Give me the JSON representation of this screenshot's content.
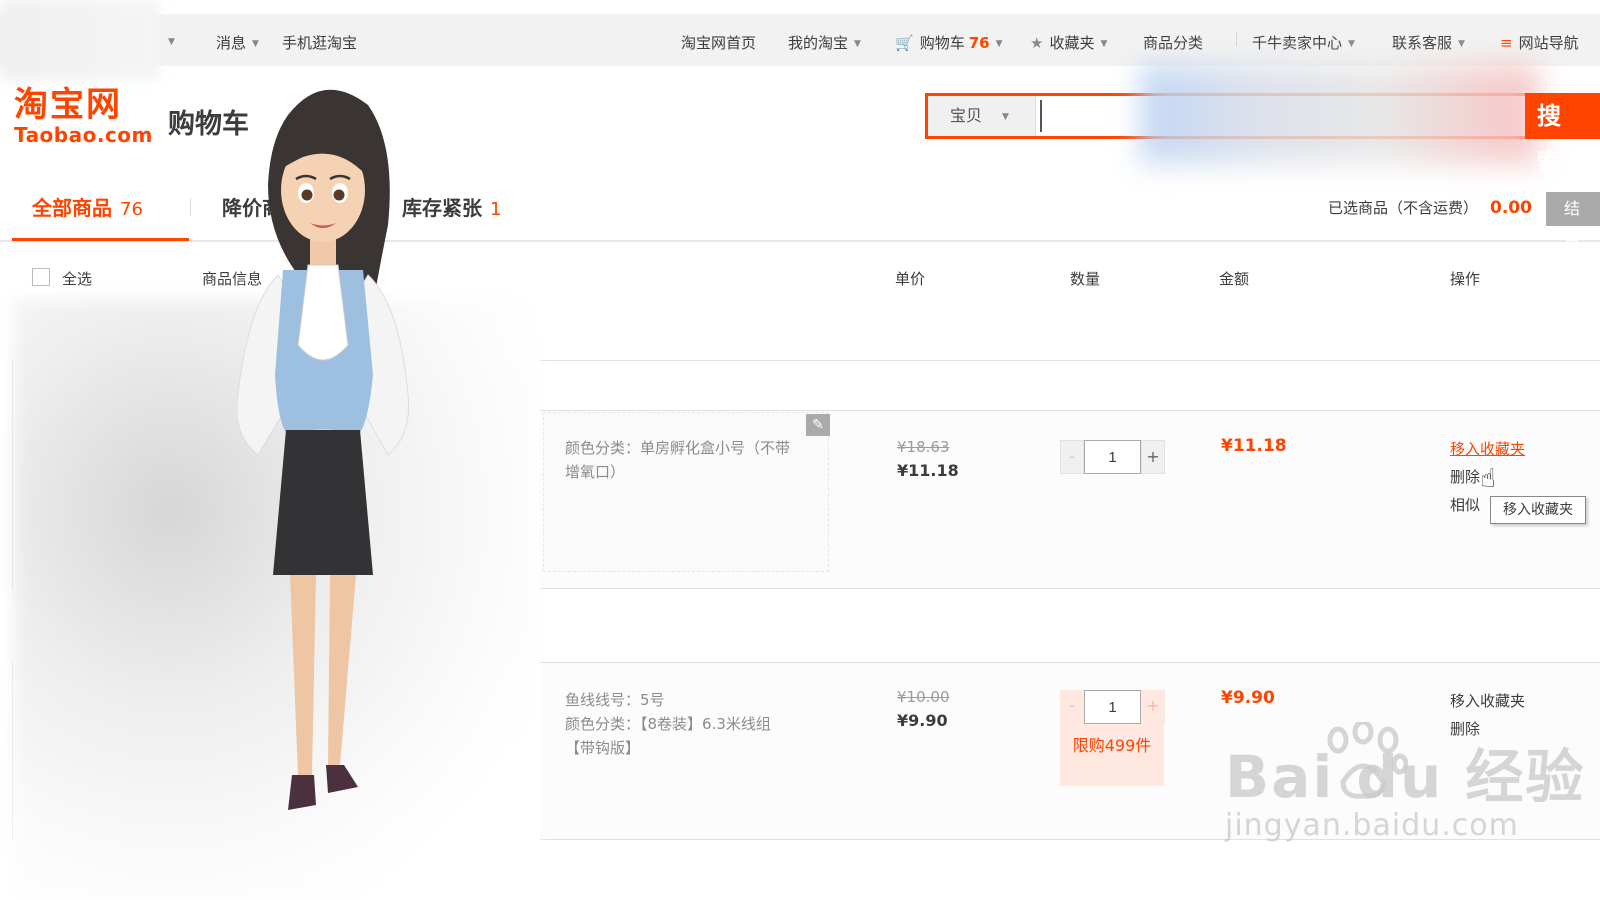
{
  "topnav": {
    "messages": "消息",
    "mobile": "手机逛淘宝",
    "home": "淘宝网首页",
    "my_taobao": "我的淘宝",
    "cart_label": "购物车",
    "cart_count": "76",
    "favorites": "收藏夹",
    "categories": "商品分类",
    "seller_center": "千牛卖家中心",
    "customer_service": "联系客服",
    "site_nav": "网站导航"
  },
  "header": {
    "logo_cn": "淘宝网",
    "logo_en": "Taobao.com",
    "page_title": "购物车"
  },
  "search": {
    "category": "宝贝",
    "value": "",
    "button": "搜 索"
  },
  "tabs": [
    {
      "label": "全部商品",
      "count": "76"
    },
    {
      "label": "降价商",
      "count": ""
    },
    {
      "label": "库存紧张",
      "count": "1"
    }
  ],
  "summary": {
    "label": "已选商品（不含运费）",
    "amount": "0.00",
    "checkout": "结 算"
  },
  "columns": {
    "select_all": "全选",
    "item_info": "商品信息",
    "unit_price": "单价",
    "quantity": "数量",
    "amount": "金额",
    "actions": "操作"
  },
  "rows": [
    {
      "props": [
        "颜色分类：单房孵化盒小号（不带",
        "增氧口）"
      ],
      "old_price": "¥18.63",
      "new_price": "¥11.18",
      "quantity": "1",
      "total": "¥11.18",
      "actions": [
        "移入收藏夹",
        "删除",
        "相似"
      ],
      "tooltip": "移入收藏夹"
    },
    {
      "props": [
        "鱼线线号：5号",
        "颜色分类：【8卷装】6.3米线组",
        "【带钩版】"
      ],
      "old_price": "¥10.00",
      "new_price": "¥9.90",
      "quantity": "1",
      "limit_note": "限购499件",
      "total": "¥9.90",
      "actions": [
        "移入收藏夹",
        "删除"
      ]
    }
  ],
  "watermark": {
    "main": "Bai du 经验",
    "sub": "jingyan.baidu.com"
  },
  "colors": {
    "accent": "#ff4400",
    "topbar_bg": "#f2f2f2",
    "muted_text": "#8c8c8c"
  }
}
